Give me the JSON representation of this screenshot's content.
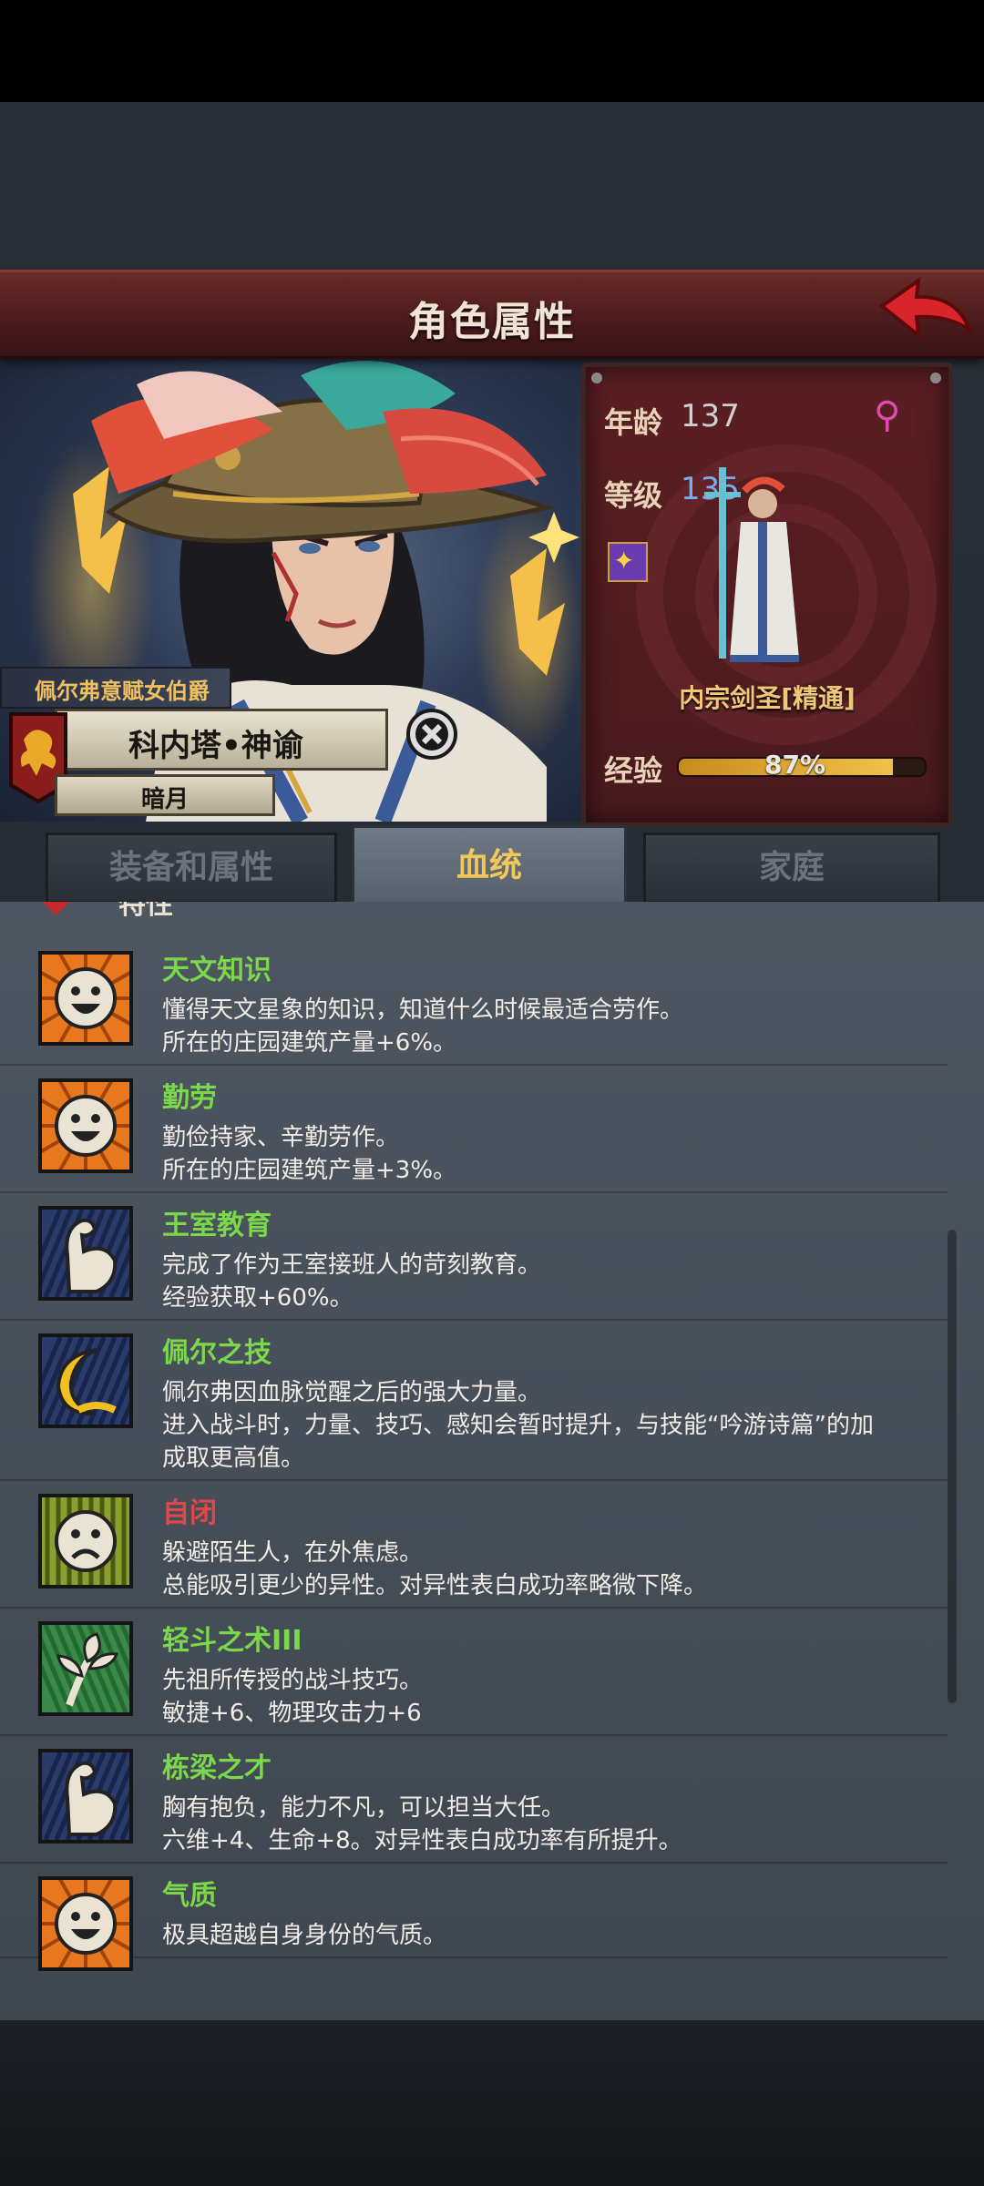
{
  "header": {
    "title": "角色属性"
  },
  "character": {
    "title": "佩尔弗意赋女伯爵",
    "name": "科内塔•神谕",
    "nickname": "暗月"
  },
  "stats": {
    "age_label": "年龄",
    "age_value": "137",
    "level_label": "等级",
    "level_value": "135",
    "class_name": "内宗剑圣[精通]",
    "exp_label": "经验",
    "exp_value": "87%",
    "exp_fraction": 0.87
  },
  "tabs": [
    {
      "label": "装备和属性"
    },
    {
      "label": "血统"
    },
    {
      "label": "家庭"
    }
  ],
  "section": {
    "label": "特性"
  },
  "traits": [
    {
      "name": "天文知识",
      "color": "#7ad84a",
      "icon": "smile-face-icon",
      "lines": [
        "懂得天文星象的知识，知道什么时候最适合劳作。",
        "所在的庄园建筑产量+6%。"
      ]
    },
    {
      "name": "勤劳",
      "color": "#7ad84a",
      "icon": "smile-face-icon",
      "lines": [
        "勤俭持家、辛勤劳作。",
        "所在的庄园建筑产量+3%。"
      ]
    },
    {
      "name": "王室教育",
      "color": "#7ad84a",
      "icon": "flexed-arm-icon",
      "lines": [
        "完成了作为王室接班人的苛刻教育。",
        "经验获取+60%。"
      ]
    },
    {
      "name": "佩尔之技",
      "color": "#7ad84a",
      "icon": "crescent-moon-icon",
      "lines": [
        "佩尔弗因血脉觉醒之后的强大力量。",
        "进入战斗时，力量、技巧、感知会暂时提升，与技能“吟游诗篇”的加",
        "成取更高值。"
      ]
    },
    {
      "name": "自闭",
      "color": "#e04848",
      "icon": "sad-face-icon",
      "lines": [
        "躲避陌生人，在外焦虑。",
        "总能吸引更少的异性。对异性表白成功率略微下降。"
      ]
    },
    {
      "name": "轻斗之术III",
      "color": "#7ad84a",
      "icon": "sprout-icon",
      "lines": [
        "先祖所传授的战斗技巧。",
        "敏捷+6、物理攻击力+6"
      ]
    },
    {
      "name": "栋梁之才",
      "color": "#7ad84a",
      "icon": "flexed-arm-icon",
      "lines": [
        "胸有抱负，能力不凡，可以担当大任。",
        "六维+4、生命+8。对异性表白成功率有所提升。"
      ]
    },
    {
      "name": "气质",
      "color": "#7ad84a",
      "icon": "smile-face-icon",
      "lines": [
        "极具超越自身身份的气质。"
      ]
    }
  ]
}
